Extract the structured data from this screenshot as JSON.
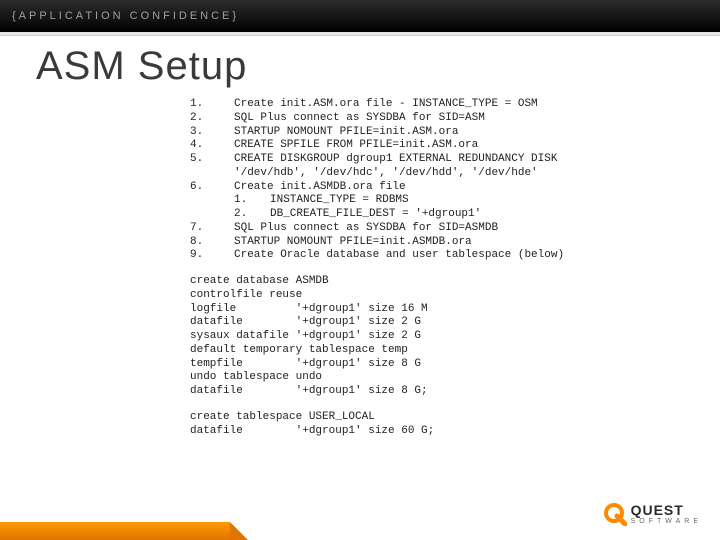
{
  "header": {
    "tag": "{APPLICATION CONFIDENCE}"
  },
  "title": "ASM Setup",
  "steps": [
    {
      "n": "1.",
      "text": "Create init.ASM.ora file - INSTANCE_TYPE = OSM"
    },
    {
      "n": "2.",
      "text": "SQL Plus connect as SYSDBA for SID=ASM"
    },
    {
      "n": "3.",
      "text": "STARTUP NOMOUNT PFILE=init.ASM.ora"
    },
    {
      "n": "4.",
      "text": "CREATE SPFILE FROM PFILE=init.ASM.ora"
    },
    {
      "n": "5.",
      "text": "CREATE DISKGROUP dgroup1 EXTERNAL REDUNDANCY DISK\n'/dev/hdb', '/dev/hdc', '/dev/hdd', '/dev/hde'"
    },
    {
      "n": "6.",
      "text": "Create init.ASMDB.ora file",
      "subs": [
        {
          "n": "1.",
          "text": "INSTANCE_TYPE = RDBMS"
        },
        {
          "n": "2.",
          "text": "DB_CREATE_FILE_DEST = '+dgroup1'"
        }
      ]
    },
    {
      "n": "7.",
      "text": "SQL Plus connect as SYSDBA for SID=ASMDB"
    },
    {
      "n": "8.",
      "text": "STARTUP NOMOUNT PFILE=init.ASMDB.ora"
    },
    {
      "n": "9.",
      "text": "Create Oracle database and user tablespace (below)"
    }
  ],
  "sql_block_1": "create database ASMDB\ncontrolfile reuse\nlogfile         '+dgroup1' size 16 M\ndatafile        '+dgroup1' size 2 G\nsysaux datafile '+dgroup1' size 2 G\ndefault temporary tablespace temp\ntempfile        '+dgroup1' size 8 G\nundo tablespace undo\ndatafile        '+dgroup1' size 8 G;",
  "sql_block_2": "create tablespace USER_LOCAL\ndatafile        '+dgroup1' size 60 G;",
  "logo": {
    "top": "QUEST",
    "bottom": "SOFTWARE"
  },
  "colors": {
    "accent": "#ff8a00"
  }
}
